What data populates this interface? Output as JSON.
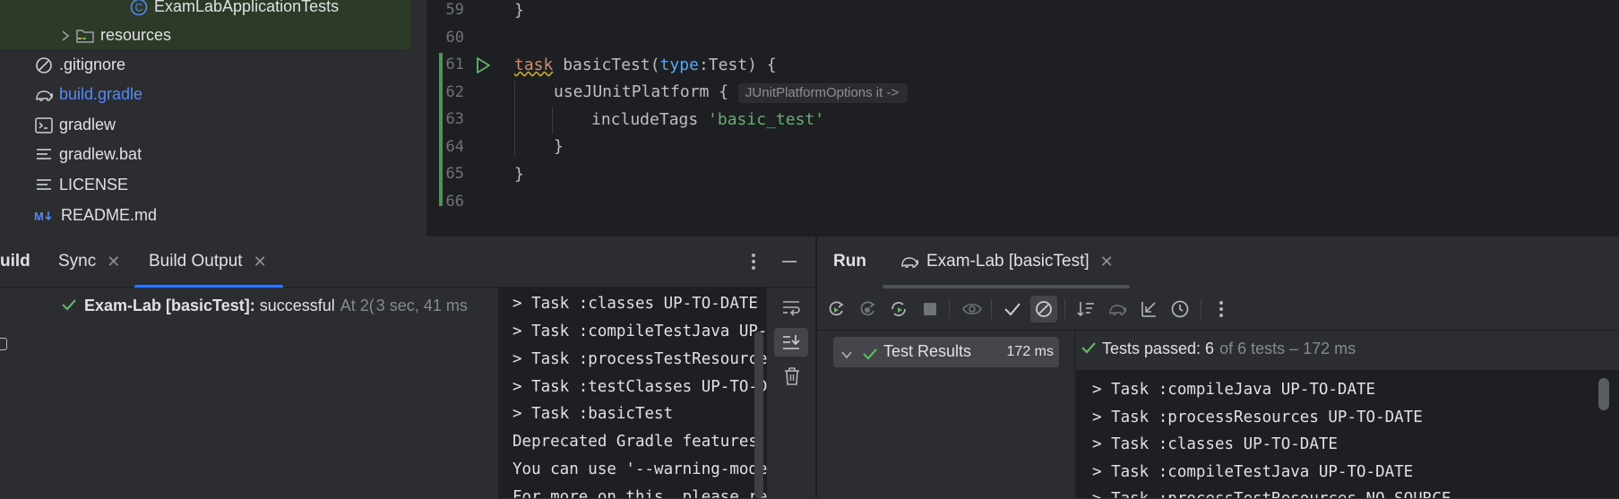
{
  "project_tree": {
    "items": [
      {
        "label": "ExamLabApplicationTests",
        "icon": "class-icon"
      },
      {
        "label": "resources",
        "icon": "resources-folder-icon"
      },
      {
        "label": ".gitignore",
        "icon": "ignore-file-icon"
      },
      {
        "label": "build.gradle",
        "icon": "gradle-elephant-icon"
      },
      {
        "label": "gradlew",
        "icon": "terminal-icon"
      },
      {
        "label": "gradlew.bat",
        "icon": "text-file-icon"
      },
      {
        "label": "LICENSE",
        "icon": "text-file-icon"
      },
      {
        "label": "README.md",
        "icon": "markdown-icon"
      }
    ]
  },
  "editor": {
    "line_numbers": [
      "59",
      "60",
      "61",
      "62",
      "63",
      "64",
      "65",
      "66"
    ],
    "lines": {
      "l59": "}",
      "l61_kw": "task",
      "l61_name": " basicTest(",
      "l61_param": "type",
      "l61_rest": ":Test) {",
      "l62_code": "useJUnitPlatform {",
      "l62_hint": "JUnitPlatformOptions it ->",
      "l63_code": "includeTags ",
      "l63_string": "'basic_test'",
      "l64": "}",
      "l65": "}"
    }
  },
  "build_panel": {
    "tabs": {
      "build": "uild",
      "sync": "Sync",
      "build_output": "Build Output"
    },
    "tree": {
      "title": "Exam-Lab [basicTest]:",
      "status": "successful",
      "at": "At 2(",
      "duration": "3 sec, 41 ms"
    },
    "console_lines": [
      "> Task :classes UP-TO-DATE",
      "> Task :compileTestJava UP-TO-DATE",
      "> Task :processTestResources NO-SOURCE",
      "> Task :testClasses UP-TO-DATE",
      "> Task :basicTest",
      "Deprecated Gradle features were used",
      "You can use '--warning-mode all'",
      "For more on this, please refer"
    ]
  },
  "run_panel": {
    "tabs": {
      "run": "Run",
      "config": "Exam-Lab [basicTest]"
    },
    "tree": {
      "root_label": "Test Results",
      "root_time": "172 ms"
    },
    "status": {
      "passed_label": "Tests passed: 6",
      "of_total": "of 6 tests – 172 ms"
    },
    "console_lines": [
      "> Task :compileJava UP-TO-DATE",
      "> Task :processResources UP-TO-DATE",
      "> Task :classes UP-TO-DATE",
      "> Task :compileTestJava UP-TO-DATE",
      "> Task :processTestResources NO-SOURCE"
    ]
  },
  "colors": {
    "accent": "#3574f0",
    "success": "#5fb865",
    "keyword": "#cf8e6d",
    "string": "#6aab73",
    "param": "#56a8f5"
  }
}
